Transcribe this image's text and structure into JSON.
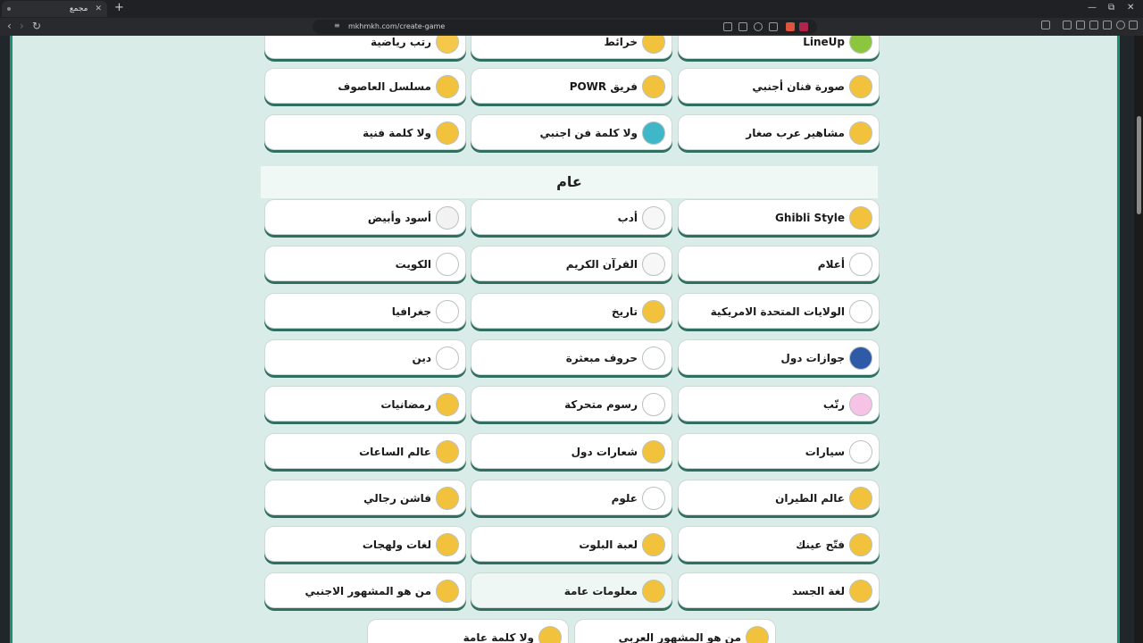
{
  "browser": {
    "tab_title": "مجمع",
    "tab_close": "✕",
    "new_tab": "+",
    "url": "mkhmkh.com/create-game",
    "win_min": "—",
    "win_max": "⧉",
    "win_close": "✕"
  },
  "section_title": "عام",
  "top_rows": [
    [
      {
        "label": "رتب رياضية",
        "icon": "ranked-sports-icon",
        "bg": "#f5c84b"
      },
      {
        "label": "خرائط",
        "icon": "map-pin-icon",
        "bg": "#f3c23c"
      },
      {
        "label": "LineUp",
        "icon": "lineup-grid-icon",
        "bg": "#8cc63f"
      }
    ],
    [
      {
        "label": "مسلسل العاصوف",
        "icon": "series-character-icon",
        "bg": "#f3c23c"
      },
      {
        "label": "فريق POWR",
        "icon": "team-powr-icon",
        "bg": "#f3c23c"
      },
      {
        "label": "صورة فنان أجنبي",
        "icon": "foreign-artist-icon",
        "bg": "#f3c23c"
      }
    ],
    [
      {
        "label": "ولا كلمة فنية",
        "icon": "art-word-icon",
        "bg": "#f3c23c"
      },
      {
        "label": "ولا كلمة فن اجنبي",
        "icon": "foreign-art-word-icon",
        "bg": "#3fb7c9"
      },
      {
        "label": "مشاهير عرب صغار",
        "icon": "young-arab-celebs-icon",
        "bg": "#f3c23c"
      }
    ]
  ],
  "general_rows": [
    [
      {
        "label": "أسود وأبيض",
        "icon": "black-white-icon",
        "bg": "#f2f2f2"
      },
      {
        "label": "أدب",
        "icon": "literature-pen-icon",
        "bg": "#f7f7f7"
      },
      {
        "label": "Ghibli Style",
        "icon": "ghibli-style-icon",
        "bg": "#f3c23c"
      }
    ],
    [
      {
        "label": "الكويت",
        "icon": "kuwait-icon",
        "bg": "#ffffff"
      },
      {
        "label": "القرآن الكريم",
        "icon": "quran-book-icon",
        "bg": "#f7f7f7"
      },
      {
        "label": "أعلام",
        "icon": "flag-icon",
        "bg": "#ffffff"
      }
    ],
    [
      {
        "label": "جغرافيا",
        "icon": "location-pin-icon",
        "bg": "#ffffff"
      },
      {
        "label": "تاريخ",
        "icon": "history-icon",
        "bg": "#f3c23c"
      },
      {
        "label": "الولايات المتحدة الامريكية",
        "icon": "usa-flag-icon",
        "bg": "#ffffff"
      }
    ],
    [
      {
        "label": "دين",
        "icon": "mosque-icon",
        "bg": "#ffffff"
      },
      {
        "label": "حروف مبعثرة",
        "icon": "scattered-letters-icon",
        "bg": "#ffffff"
      },
      {
        "label": "جوازات دول",
        "icon": "passport-icon",
        "bg": "#2e5aa8"
      }
    ],
    [
      {
        "label": "رمضانيات",
        "icon": "ramadan-icon",
        "bg": "#f3c23c"
      },
      {
        "label": "رسوم متحركة",
        "icon": "cartoons-icon",
        "bg": "#ffffff"
      },
      {
        "label": "رتّب",
        "icon": "arrange-icon",
        "bg": "#f6c2e6"
      }
    ],
    [
      {
        "label": "عالم الساعات",
        "icon": "watches-icon",
        "bg": "#f3c23c"
      },
      {
        "label": "شعارات دول",
        "icon": "country-logos-icon",
        "bg": "#f3c23c"
      },
      {
        "label": "سيارات",
        "icon": "car-icon",
        "bg": "#ffffff"
      }
    ],
    [
      {
        "label": "فاشن رجالي",
        "icon": "mens-fashion-icon",
        "bg": "#f3c23c"
      },
      {
        "label": "علوم",
        "icon": "atom-icon",
        "bg": "#ffffff"
      },
      {
        "label": "عالم الطيران",
        "icon": "aviation-icon",
        "bg": "#f3c23c"
      }
    ],
    [
      {
        "label": "لغات ولهجات",
        "icon": "languages-icon",
        "bg": "#f3c23c"
      },
      {
        "label": "لعبة البلوت",
        "icon": "baloot-cards-icon",
        "bg": "#f3c23c"
      },
      {
        "label": "فتّح عينك",
        "icon": "open-eyes-icon",
        "bg": "#f3c23c"
      }
    ],
    [
      {
        "label": "من هو المشهور الاجنبي",
        "icon": "foreign-celebrity-icon",
        "bg": "#f3c23c"
      },
      {
        "label": "معلومات عامة",
        "icon": "info-icon",
        "bg": "#f3c23c",
        "highlight": true
      },
      {
        "label": "لغة الجسد",
        "icon": "body-language-icon",
        "bg": "#f3c23c"
      }
    ]
  ],
  "bottom_row": [
    {
      "label": "ولا كلمة عامة",
      "icon": "general-word-icon",
      "bg": "#f3c23c"
    },
    {
      "label": "من هو المشهور العربي",
      "icon": "arab-celebrity-icon",
      "bg": "#f3c23c"
    }
  ]
}
